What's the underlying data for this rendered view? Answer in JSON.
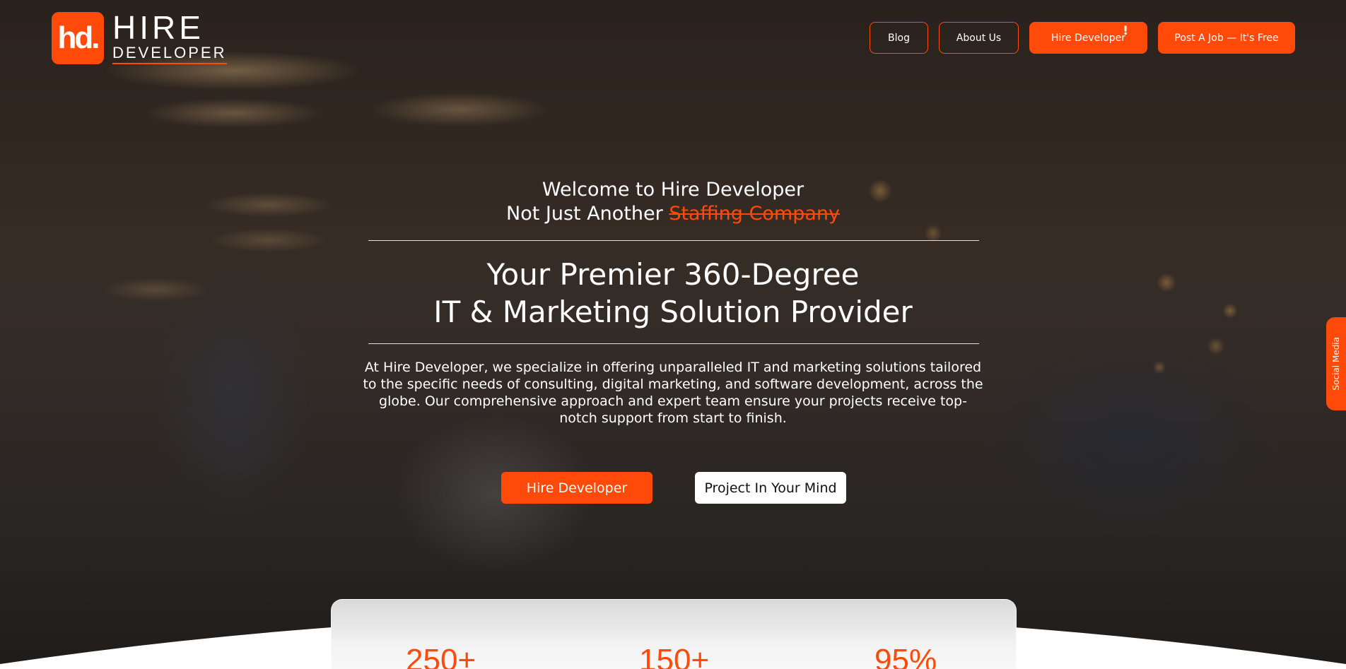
{
  "brand": {
    "mark": "hd.",
    "name_line1": "HIRE",
    "name_line2": "DEVELOPER",
    "accent_color": "#ff4a0a"
  },
  "nav": {
    "items": [
      {
        "label": "Blog",
        "style": "outline"
      },
      {
        "label": "About Us",
        "style": "outline"
      },
      {
        "label": "Hire Developer",
        "style": "solid",
        "badge": "!"
      },
      {
        "label": "Post A Job — It's Free",
        "style": "solid"
      }
    ]
  },
  "hero": {
    "welcome_line1": "Welcome to Hire Developer",
    "welcome_line2_prefix": "Not Just Another ",
    "welcome_line2_strike": "Staffing Company",
    "headline_line1": "Your Premier 360-Degree",
    "headline_line2": "IT & Marketing Solution Provider",
    "description": "At Hire Developer, we specialize in offering unparalleled IT and marketing solutions tailored to the specific needs of consulting, digital marketing, and software development, across the globe. Our comprehensive approach and expert team ensure your projects receive top-notch support from start to finish.",
    "cta_primary": "Hire Developer",
    "cta_secondary": "Project In Your Mind"
  },
  "social_tab": {
    "label": "Social Media"
  },
  "stats": [
    {
      "value": "250+"
    },
    {
      "value": "150+"
    },
    {
      "value": "95%"
    }
  ]
}
